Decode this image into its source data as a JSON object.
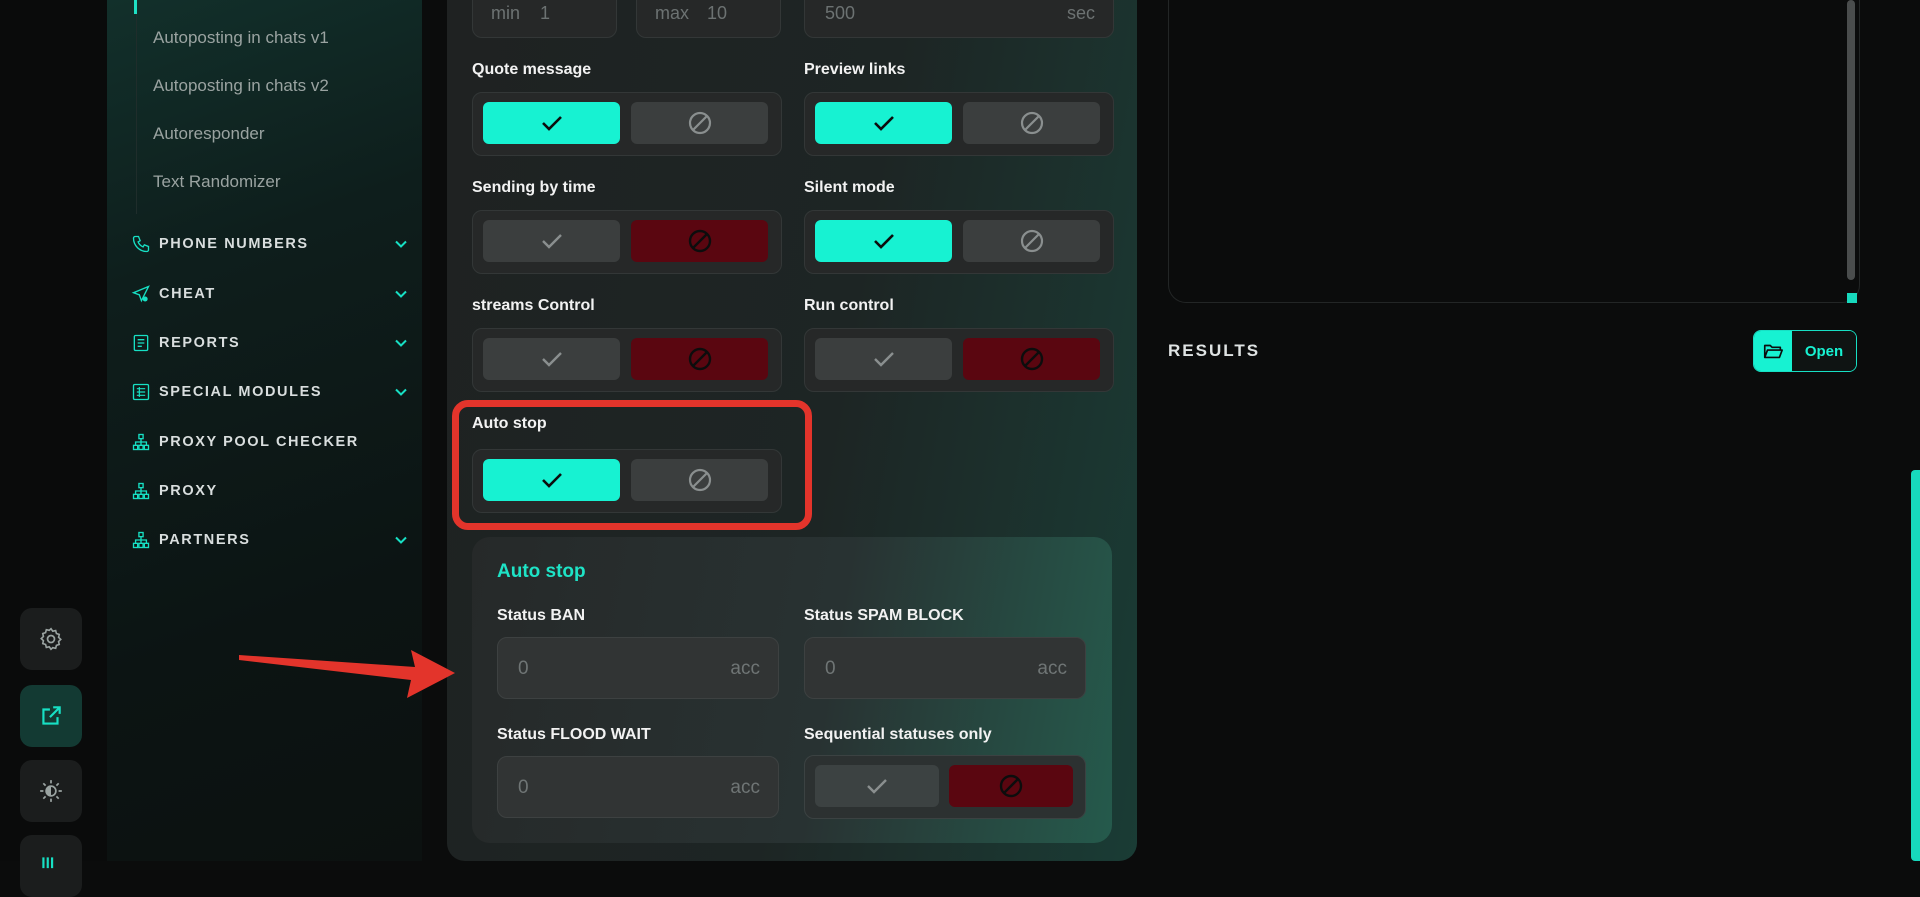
{
  "sidebar": {
    "sub_items": [
      "Autoposting in chats v1",
      "Autoposting in chats v2",
      "Autoresponder",
      "Text Randomizer"
    ],
    "nav": [
      {
        "label": "PHONE NUMBERS"
      },
      {
        "label": "CHEAT"
      },
      {
        "label": "REPORTS"
      },
      {
        "label": "SPECIAL MODULES"
      },
      {
        "label": "PROXY POOL CHECKER"
      },
      {
        "label": "PROXY"
      },
      {
        "label": "PARTNERS"
      }
    ]
  },
  "form": {
    "top_inputs": {
      "min_label": "min",
      "min_value": "1",
      "max_label": "max",
      "max_value": "10",
      "delay_value": "500",
      "delay_unit": "sec"
    },
    "toggles": {
      "quote_message": "Quote message",
      "preview_links": "Preview links",
      "sending_by_time": "Sending by time",
      "silent_mode": "Silent mode",
      "streams_control": "streams Control",
      "run_control": "Run control",
      "auto_stop": "Auto stop"
    },
    "auto_stop_panel": {
      "title": "Auto stop",
      "status_ban": "Status BAN",
      "status_spam_block": "Status SPAM BLOCK",
      "status_flood_wait": "Status FLOOD WAIT",
      "sequential_statuses_only": "Sequential statuses only",
      "ban_value": "0",
      "spam_value": "0",
      "flood_value": "0",
      "unit": "acc"
    }
  },
  "results": {
    "title": "RESULTS",
    "open_label": "Open"
  },
  "colors": {
    "accent": "#17f2d2",
    "danger": "#5a0610",
    "highlight": "#e3342b"
  }
}
